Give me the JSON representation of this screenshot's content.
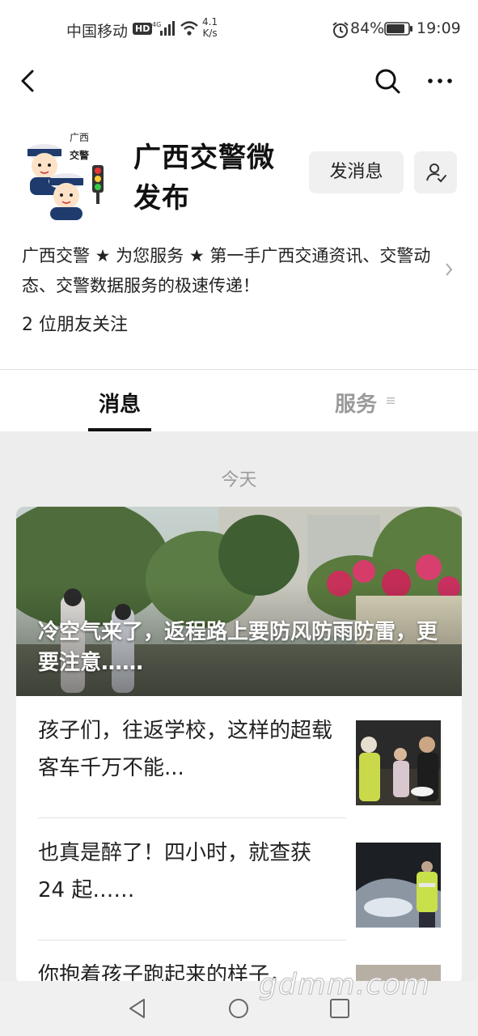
{
  "status_bar": {
    "carrier": "中国移动",
    "hd": "HD",
    "speed_value": "4.1",
    "speed_unit": "K/s",
    "battery": "84%",
    "time": "19:09"
  },
  "nav": {
    "back_icon": "back-arrow-icon",
    "search_icon": "search-icon",
    "more_icon": "more-icon"
  },
  "profile": {
    "name": "广西交警微发布",
    "send_message": "发消息",
    "description": "广西交警 ★ 为您服务 ★ 第一手广西交通资讯、交警动态、交警数据服务的极速传递！",
    "followers": "2 位朋友关注",
    "avatar_text_1": "广西",
    "avatar_text_2": "交警"
  },
  "tabs": [
    {
      "label": "消息",
      "active": true
    },
    {
      "label": "服务",
      "active": false
    }
  ],
  "feed": {
    "date": "今天",
    "cover_title": "冷空气来了，返程路上要防风防雨防雷，更要注意……",
    "items": [
      {
        "title": "孩子们，往返学校，这样的超载客车千万不能..."
      },
      {
        "title": "也真是醉了！四小时，就查获 24 起……"
      },
      {
        "title": "你抱着孩子跑起来的样子，"
      }
    ]
  },
  "watermark": "gdmm.com",
  "colors": {
    "background": "#ededed",
    "card": "#ffffff",
    "muted": "#9a9a9a"
  }
}
